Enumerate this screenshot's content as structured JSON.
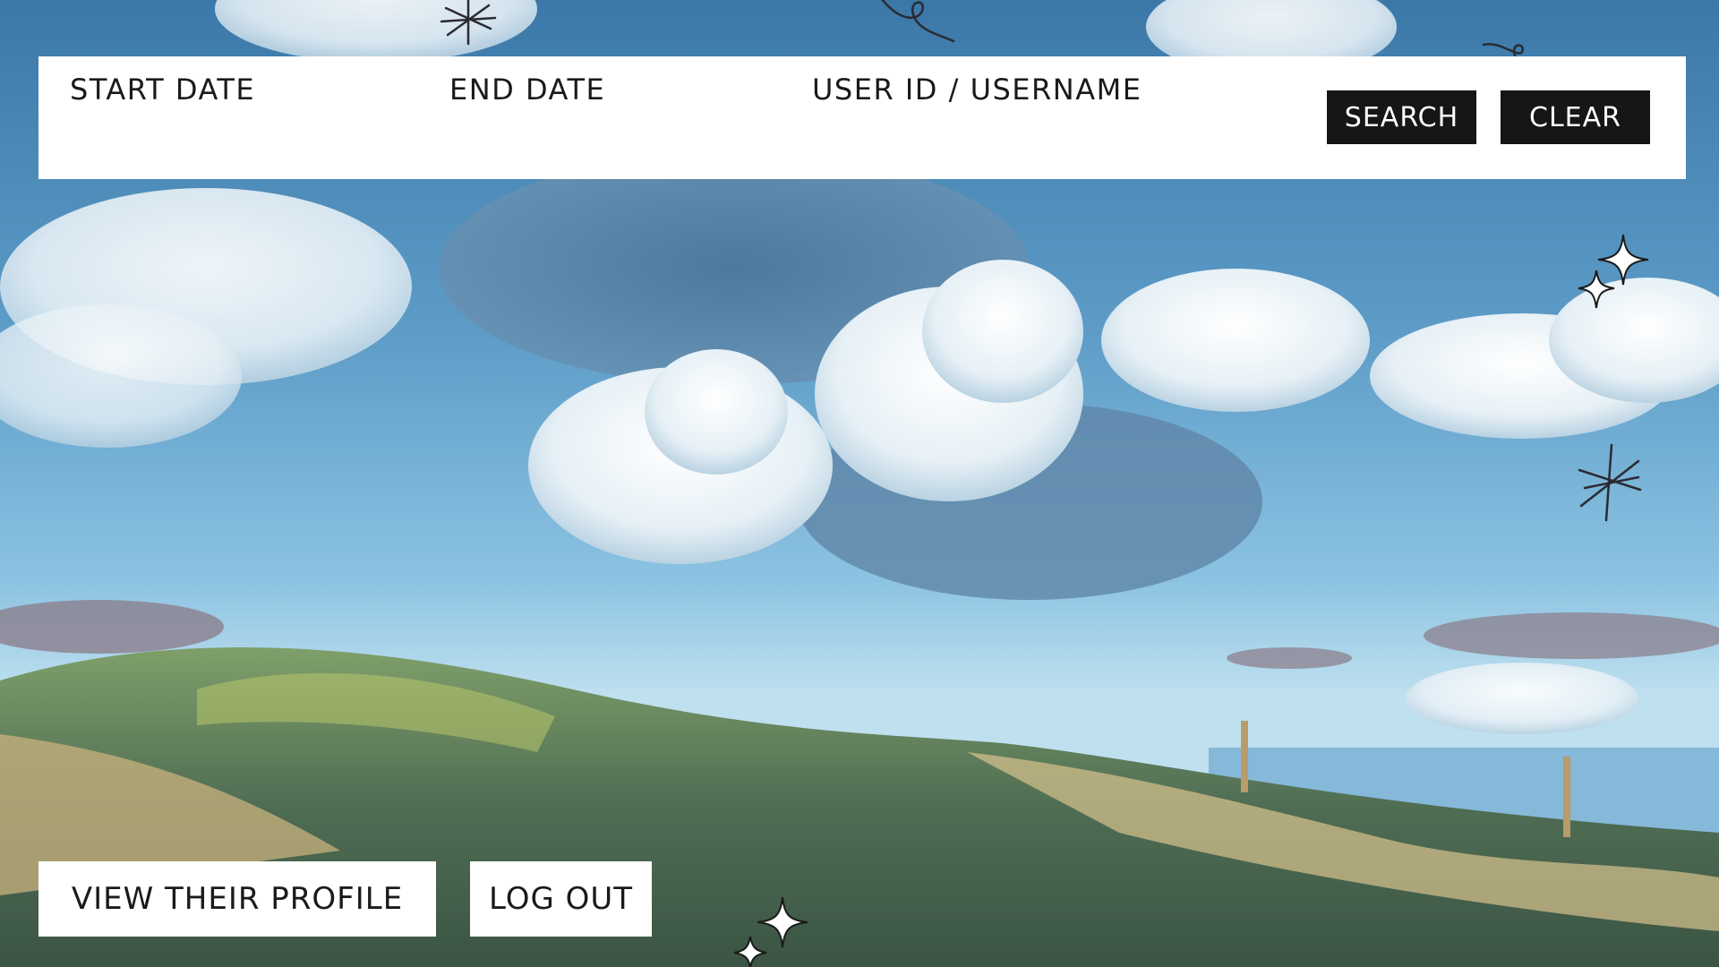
{
  "filter": {
    "start_date_label": "START DATE",
    "end_date_label": "END DATE",
    "user_label": "USER ID / USERNAME",
    "start_date_value": "",
    "end_date_value": "",
    "user_value": "",
    "search_button": "SEARCH",
    "clear_button": "CLEAR"
  },
  "actions": {
    "view_profile": "VIEW THEIR PROFILE",
    "log_out": "LOG OUT"
  },
  "icons": [
    "sparkle-icon",
    "asterisk-icon",
    "swirl-icon"
  ],
  "colors": {
    "panel": "#ffffff",
    "dark_button": "#171515",
    "text": "#1a1a1a"
  }
}
